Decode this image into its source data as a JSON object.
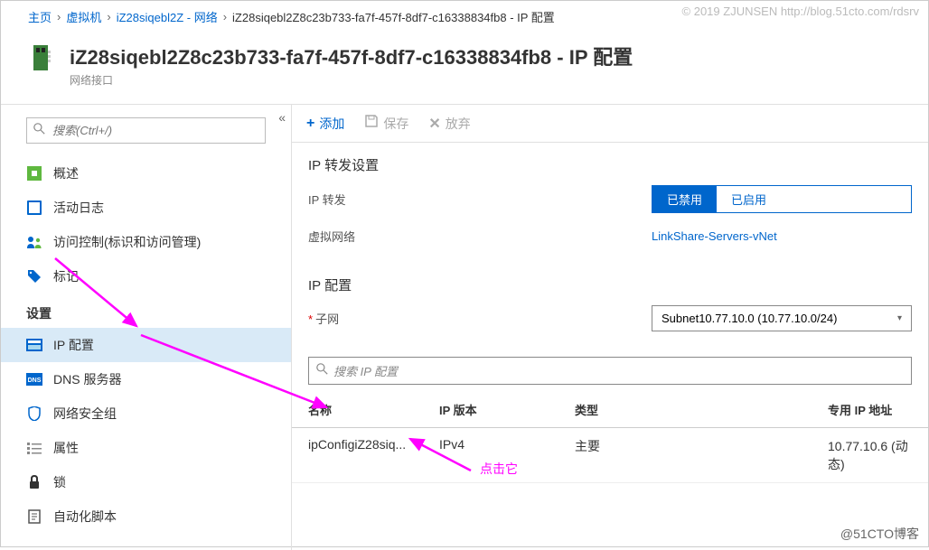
{
  "watermark": "© 2019 ZJUNSEN http://blog.51cto.com/rdsrv",
  "footer_watermark": "@51CTO博客",
  "breadcrumb": {
    "items": [
      "主页",
      "虚拟机",
      "iZ28siqebl2Z - 网络",
      "iZ28siqebl2Z8c23b733-fa7f-457f-8df7-c16338834fb8 - IP 配置"
    ]
  },
  "title": {
    "main": "iZ28siqebl2Z8c23b733-fa7f-457f-8df7-c16338834fb8 - IP 配置",
    "sub": "网络接口"
  },
  "sidebar": {
    "search_placeholder": "搜索(Ctrl+/)",
    "items": [
      {
        "label": "概述"
      },
      {
        "label": "活动日志"
      },
      {
        "label": "访问控制(标识和访问管理)"
      },
      {
        "label": "标记"
      }
    ],
    "settings_header": "设置",
    "settings_items": [
      {
        "label": "IP 配置",
        "active": true
      },
      {
        "label": "DNS 服务器"
      },
      {
        "label": "网络安全组"
      },
      {
        "label": "属性"
      },
      {
        "label": "锁"
      },
      {
        "label": "自动化脚本"
      }
    ]
  },
  "toolbar": {
    "add": "添加",
    "save": "保存",
    "discard": "放弃"
  },
  "forwarding": {
    "section": "IP 转发设置",
    "label": "IP 转发",
    "disabled": "已禁用",
    "enabled": "已启用",
    "vnet_label": "虚拟网络",
    "vnet_value": "LinkShare-Servers-vNet"
  },
  "ipconfig": {
    "section": "IP 配置",
    "subnet_label": "子网",
    "subnet_value": "Subnet10.77.10.0 (10.77.10.0/24)",
    "search_placeholder": "搜索 IP 配置"
  },
  "table": {
    "headers": {
      "name": "名称",
      "version": "IP 版本",
      "type": "类型",
      "ip": "专用 IP 地址"
    },
    "rows": [
      {
        "name": "ipConfigiZ28siq...",
        "version": "IPv4",
        "type": "主要",
        "ip": "10.77.10.6 (动态)"
      }
    ]
  },
  "annotation": "点击它"
}
